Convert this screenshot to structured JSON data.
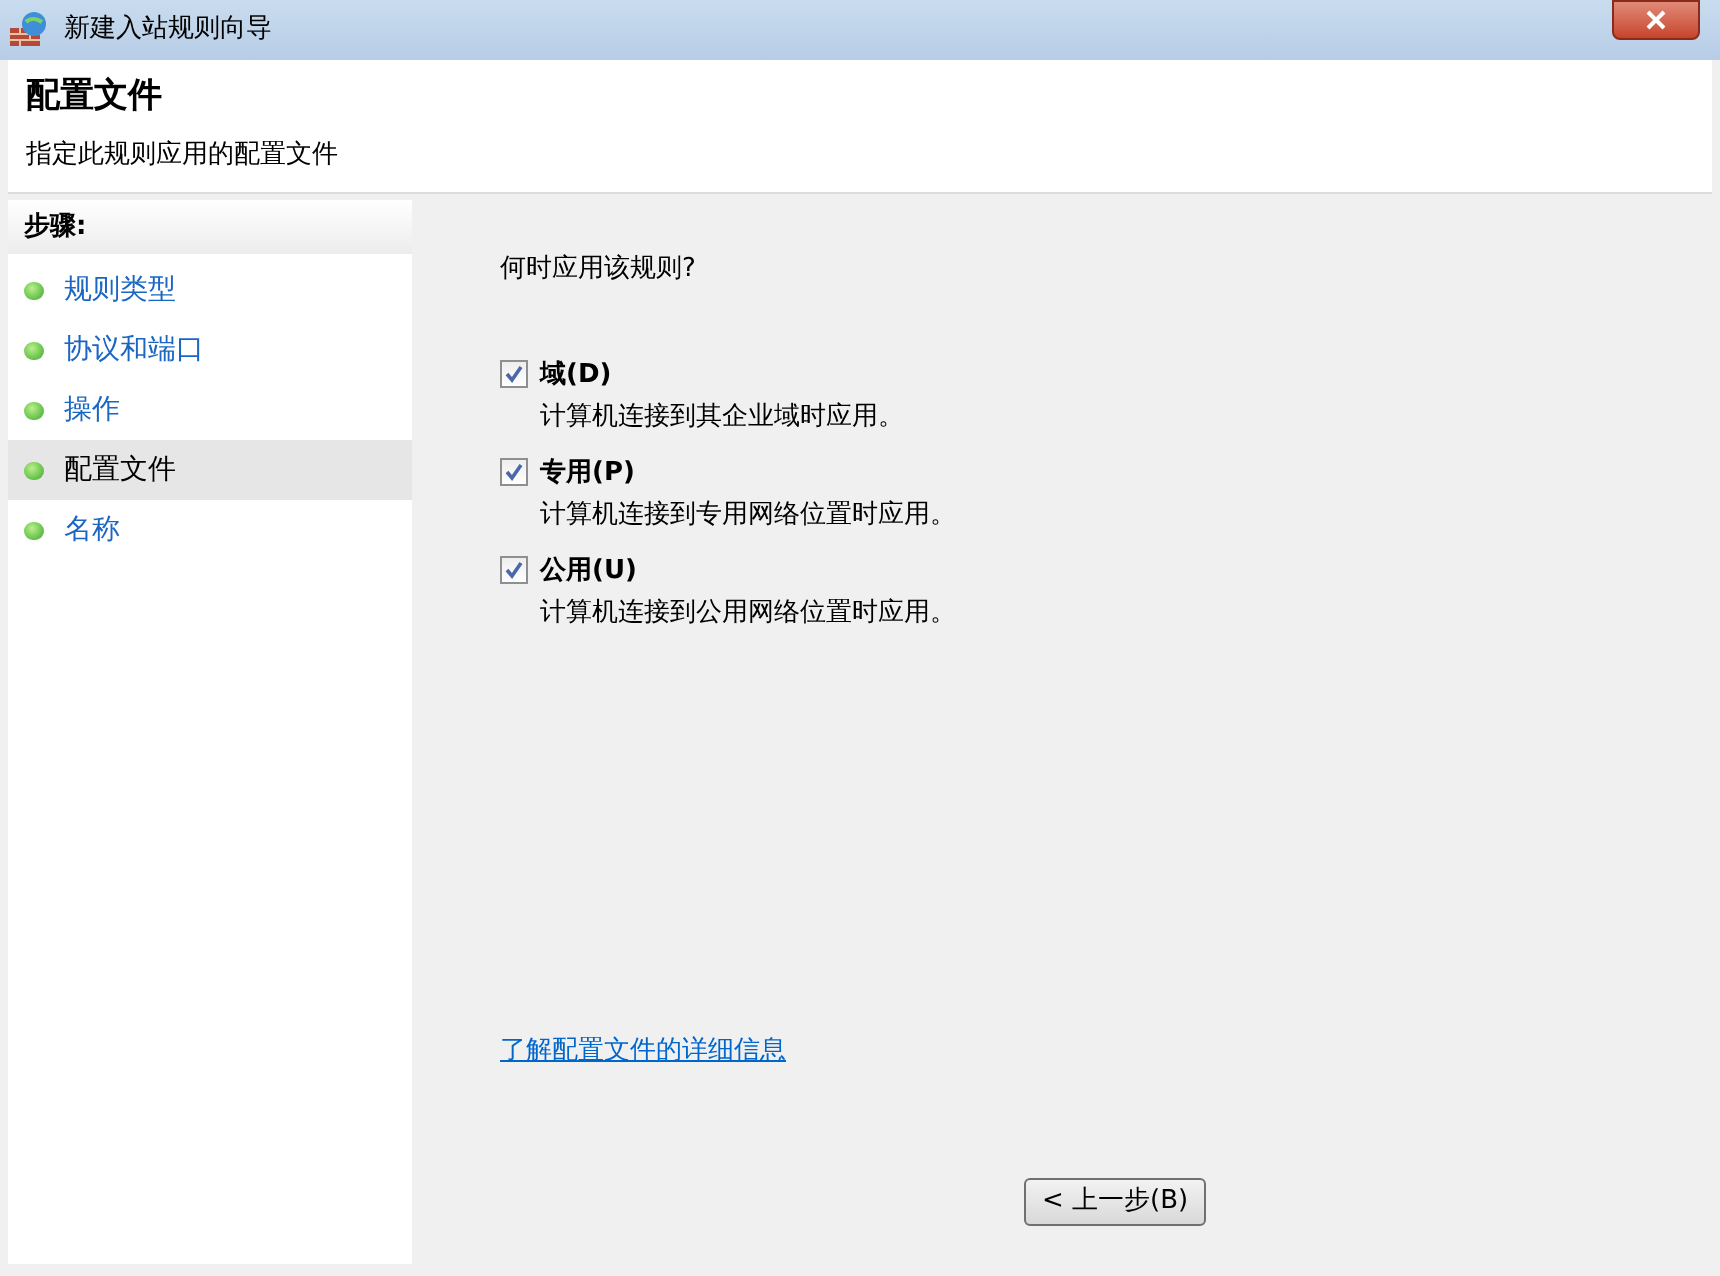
{
  "window": {
    "title": "新建入站规则向导"
  },
  "header": {
    "title": "配置文件",
    "subtitle": "指定此规则应用的配置文件"
  },
  "steps": {
    "heading": "步骤:",
    "items": [
      {
        "label": "规则类型",
        "selected": false
      },
      {
        "label": "协议和端口",
        "selected": false
      },
      {
        "label": "操作",
        "selected": false
      },
      {
        "label": "配置文件",
        "selected": true
      },
      {
        "label": "名称",
        "selected": false
      }
    ]
  },
  "content": {
    "question": "何时应用该规则?",
    "options": [
      {
        "label": "域(D)",
        "description": "计算机连接到其企业域时应用。",
        "checked": true
      },
      {
        "label": "专用(P)",
        "description": "计算机连接到专用网络位置时应用。",
        "checked": true
      },
      {
        "label": "公用(U)",
        "description": "计算机连接到公用网络位置时应用。",
        "checked": true
      }
    ],
    "link": "了解配置文件的详细信息"
  },
  "buttons": [
    {
      "label": "< 上一步(B)"
    }
  ]
}
